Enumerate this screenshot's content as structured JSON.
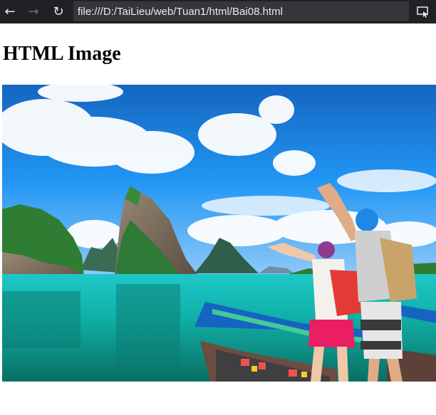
{
  "browser": {
    "back_icon": "back-arrow-icon",
    "forward_icon": "forward-arrow-icon",
    "reload_icon": "reload-icon",
    "url": "file:///D:/TaiLieu/web/Tuan1/html/Bai08.html",
    "extension_icon": "screen-cast-icon"
  },
  "page": {
    "heading": "HTML Image"
  },
  "image": {
    "subject": "travelers-on-boat-with-limestone-islands-and-turquoise-sea",
    "colors": {
      "sky": "#1e88e5",
      "sea": "#13b3b0",
      "rock": "#7d6f5e",
      "jungle": "#2e7d32"
    }
  }
}
